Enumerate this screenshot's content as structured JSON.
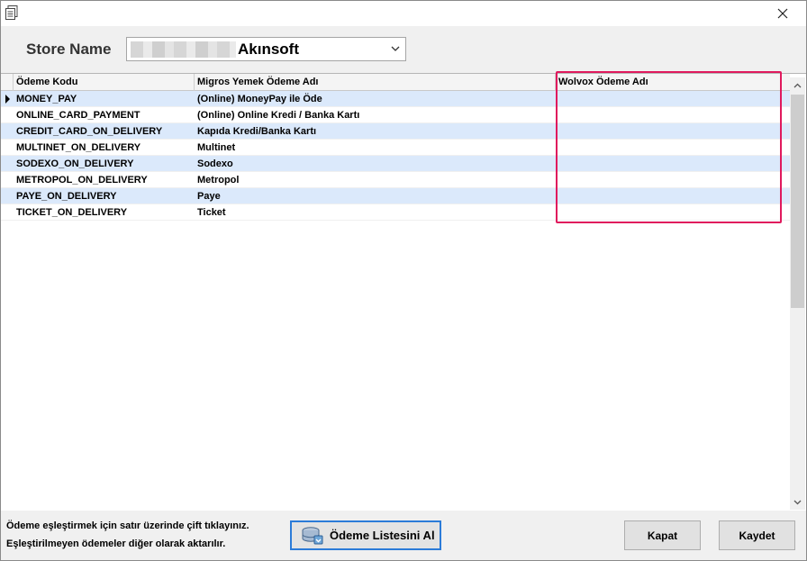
{
  "store": {
    "label": "Store Name",
    "selected_value": "Akınsoft"
  },
  "grid": {
    "columns": [
      "Ödeme Kodu",
      "Migros Yemek Ödeme Adı",
      "Wolvox Ödeme Adı"
    ],
    "rows": [
      {
        "code": "MONEY_PAY",
        "migros": "(Online) MoneyPay ile Öde",
        "wolvox": ""
      },
      {
        "code": "ONLINE_CARD_PAYMENT",
        "migros": "(Online) Online Kredi / Banka Kartı",
        "wolvox": ""
      },
      {
        "code": "CREDIT_CARD_ON_DELIVERY",
        "migros": "Kapıda Kredi/Banka Kartı",
        "wolvox": ""
      },
      {
        "code": "MULTINET_ON_DELIVERY",
        "migros": "Multinet",
        "wolvox": ""
      },
      {
        "code": "SODEXO_ON_DELIVERY",
        "migros": "Sodexo",
        "wolvox": ""
      },
      {
        "code": "METROPOL_ON_DELIVERY",
        "migros": "Metropol",
        "wolvox": ""
      },
      {
        "code": "PAYE_ON_DELIVERY",
        "migros": "Paye",
        "wolvox": ""
      },
      {
        "code": "TICKET_ON_DELIVERY",
        "migros": "Ticket",
        "wolvox": ""
      }
    ]
  },
  "footer": {
    "info_line1": "Ödeme eşleştirmek için satır üzerinde çift tıklayınız.",
    "info_line2": "Eşleştirilmeyen ödemeler diğer olarak aktarılır.",
    "fetch_button": "Ödeme Listesini Al",
    "close_button": "Kapat",
    "save_button": "Kaydet"
  },
  "colors": {
    "alt_row": "#dbe9fb",
    "highlight": "#e0195d",
    "focus_border": "#2b7bd8"
  },
  "icons": {
    "window": "document-icon",
    "close": "close-icon",
    "dropdown": "chevron-down-icon",
    "fetch": "database-download-icon",
    "current_row": "row-indicator-icon"
  }
}
